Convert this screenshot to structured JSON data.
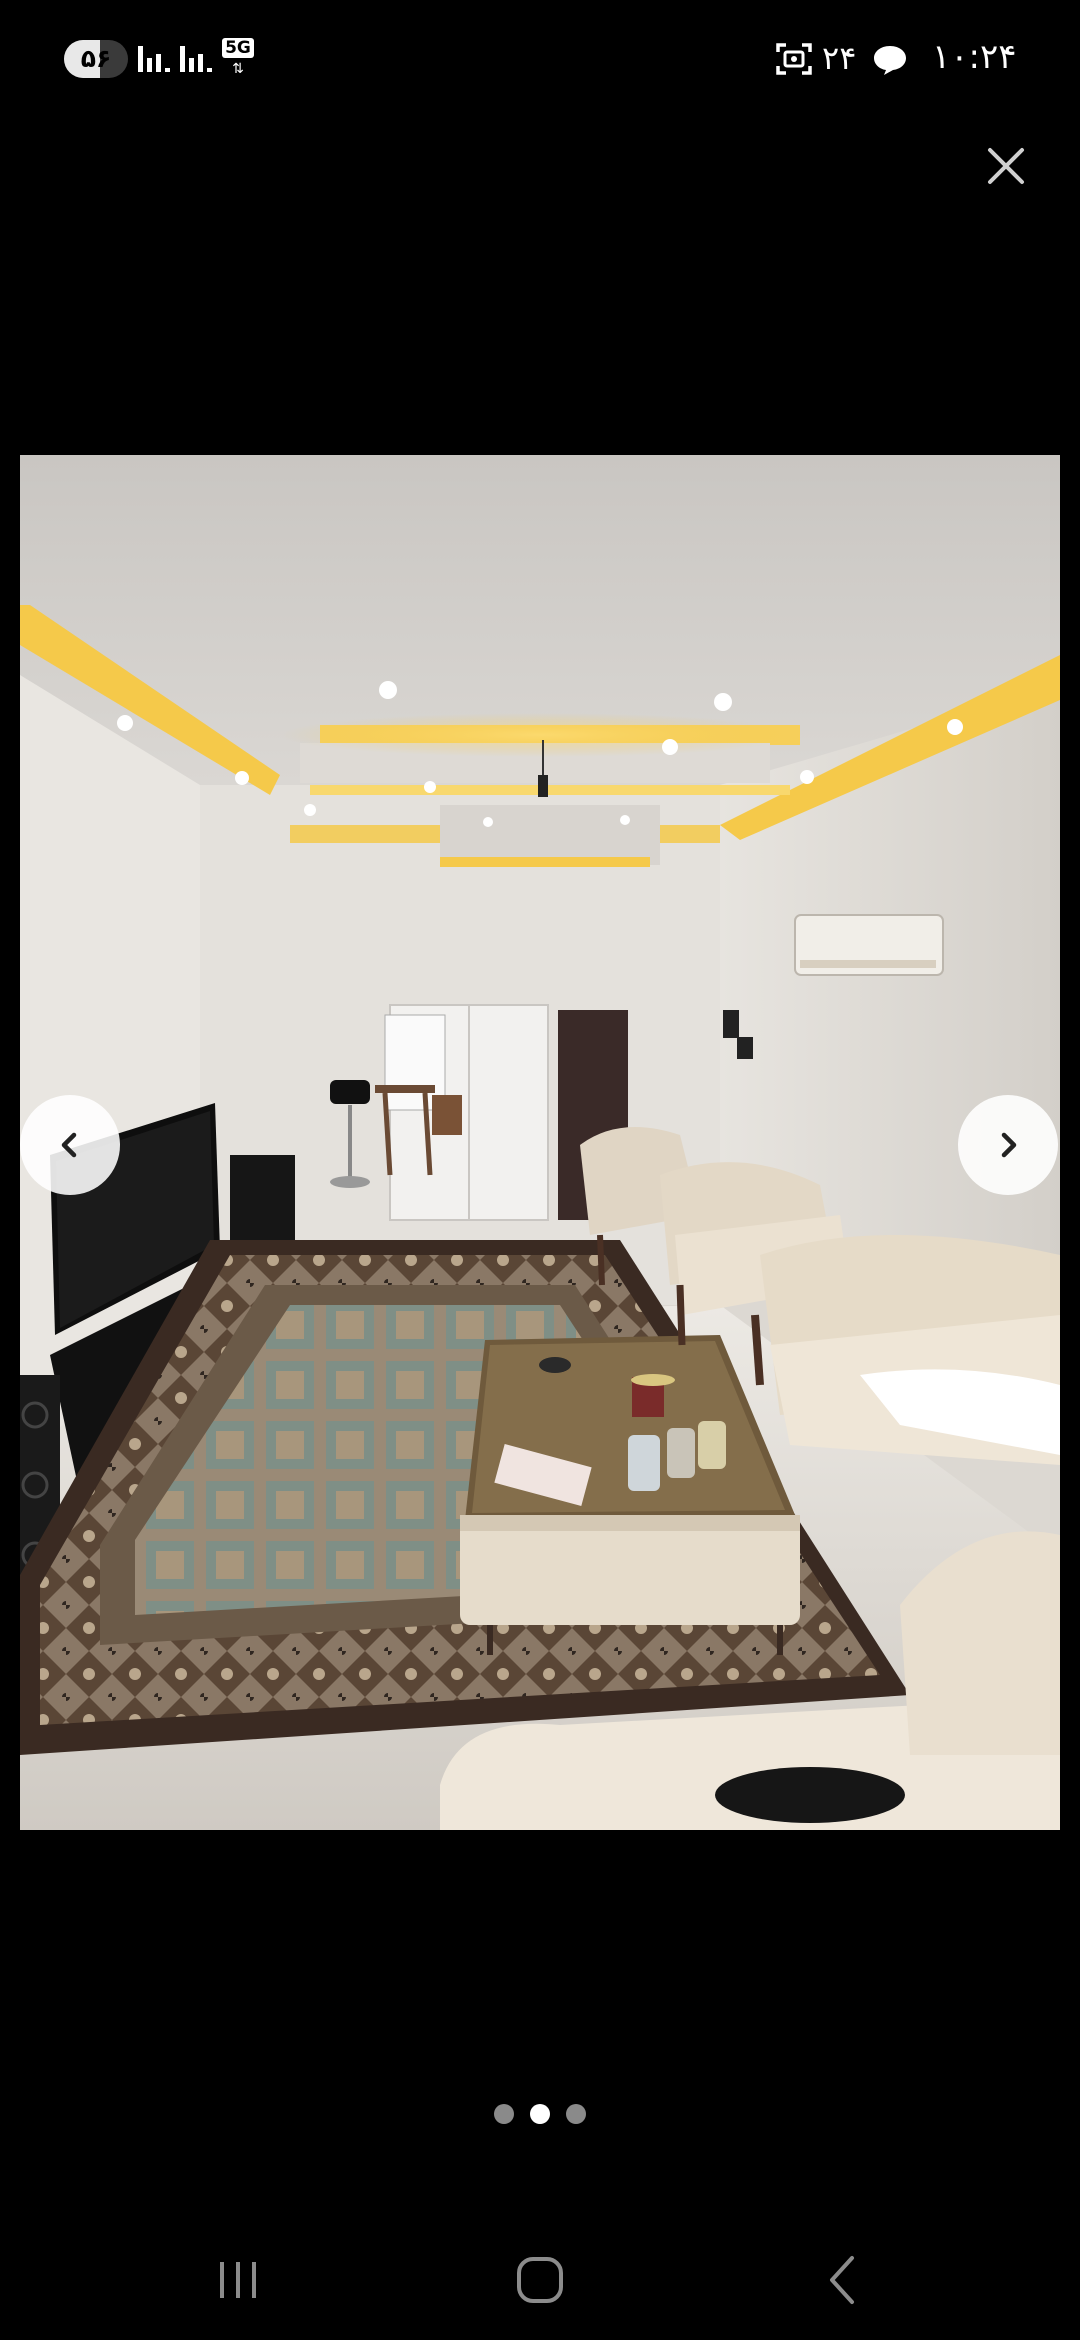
{
  "status_bar": {
    "battery_level": "۵۶",
    "battery_percent": 56,
    "network_type": "5G",
    "network_arrows": "⇅",
    "notification_count": "۲۴",
    "time": "۱۰:۲۴"
  },
  "icons": {
    "close": "close-icon",
    "prev": "chevron-left-icon",
    "next": "chevron-right-icon",
    "recent": "recent-apps-icon",
    "home": "home-icon",
    "back": "back-icon",
    "screenshot": "screenshot-icon",
    "chat": "chat-bubble-icon",
    "signal": "signal-bars-icon"
  },
  "gallery": {
    "total_images": 3,
    "current_index": 2
  },
  "colors": {
    "background": "#000000",
    "dot_inactive": "#8a8a8a",
    "dot_active": "#ffffff",
    "ceiling_glow": "#f5c94a"
  }
}
